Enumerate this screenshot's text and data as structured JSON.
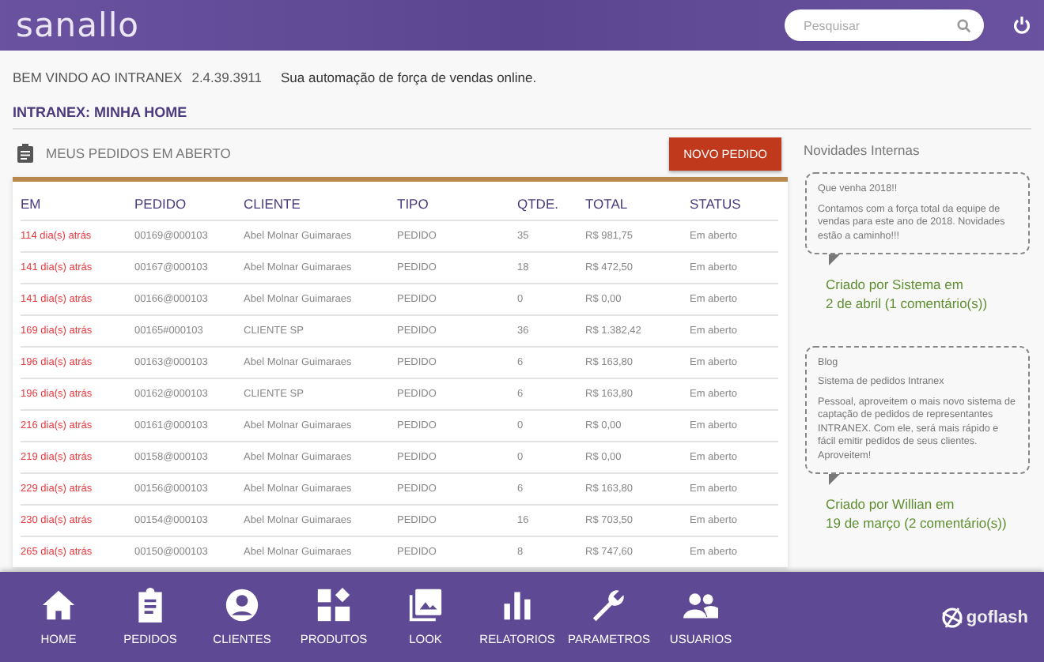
{
  "header": {
    "logo": "sanallo",
    "search": {
      "placeholder": "Pesquisar"
    }
  },
  "welcome": {
    "title": "BEM VINDO AO INTRANEX",
    "version": "2.4.39.3911",
    "tagline": "Sua automação de força de vendas online."
  },
  "page_title": "INTRANEX: MINHA HOME",
  "orders": {
    "title": "MEUS PEDIDOS EM ABERTO",
    "new_button": "NOVO PEDIDO",
    "columns": [
      "EM",
      "PEDIDO",
      "CLIENTE",
      "TIPO",
      "QTDE.",
      "TOTAL",
      "STATUS"
    ],
    "rows": [
      [
        "114 dia(s) atrás",
        "00169@000103",
        "Abel Molnar Guimaraes",
        "PEDIDO",
        "35",
        "R$ 981,75",
        "Em aberto"
      ],
      [
        "141 dia(s) atrás",
        "00167@000103",
        "Abel Molnar Guimaraes",
        "PEDIDO",
        "18",
        "R$ 472,50",
        "Em aberto"
      ],
      [
        "141 dia(s) atrás",
        "00166@000103",
        "Abel Molnar Guimaraes",
        "PEDIDO",
        "0",
        "R$ 0,00",
        "Em aberto"
      ],
      [
        "169 dia(s) atrás",
        "00165#000103",
        "CLIENTE SP",
        "PEDIDO",
        "36",
        "R$ 1.382,42",
        "Em aberto"
      ],
      [
        "196 dia(s) atrás",
        "00163@000103",
        "Abel Molnar Guimaraes",
        "PEDIDO",
        "6",
        "R$ 163,80",
        "Em aberto"
      ],
      [
        "196 dia(s) atrás",
        "00162@000103",
        "CLIENTE SP",
        "PEDIDO",
        "6",
        "R$ 163,80",
        "Em aberto"
      ],
      [
        "216 dia(s) atrás",
        "00161@000103",
        "Abel Molnar Guimaraes",
        "PEDIDO",
        "0",
        "R$ 0,00",
        "Em aberto"
      ],
      [
        "219 dia(s) atrás",
        "00158@000103",
        "Abel Molnar Guimaraes",
        "PEDIDO",
        "0",
        "R$ 0,00",
        "Em aberto"
      ],
      [
        "229 dia(s) atrás",
        "00156@000103",
        "Abel Molnar Guimaraes",
        "PEDIDO",
        "6",
        "R$ 163,80",
        "Em aberto"
      ],
      [
        "230 dia(s) atrás",
        "00154@000103",
        "Abel Molnar Guimaraes",
        "PEDIDO",
        "16",
        "R$ 703,50",
        "Em aberto"
      ],
      [
        "265 dia(s) atrás",
        "00150@000103",
        "Abel Molnar Guimaraes",
        "PEDIDO",
        "8",
        "R$ 747,60",
        "Em aberto"
      ]
    ]
  },
  "news": {
    "title": "Novidades Internas",
    "posts": [
      {
        "title": "Que venha 2018!!",
        "body": "Contamos com a força total da equipe de vendas para este ano de 2018. Novidades estão a caminho!!!",
        "created_line": "Criado por Sistema em",
        "date_line": "2 de abril (1 comentário(s))"
      },
      {
        "category": "Blog",
        "title": "Sistema de pedidos Intranex",
        "body": "Pessoal, aproveitem o mais novo sistema de captação de pedidos de representantes INTRANEX. Com ele, será mais rápido e fácil emitir pedidos de seus clientes. Aproveitem!",
        "created_line": "Criado por Willian em",
        "date_line": "19 de março (2 comentário(s))"
      }
    ]
  },
  "nav": [
    {
      "label": "HOME"
    },
    {
      "label": "PEDIDOS"
    },
    {
      "label": "CLIENTES"
    },
    {
      "label": "PRODUTOS"
    },
    {
      "label": "LOOK"
    },
    {
      "label": "RELATORIOS"
    },
    {
      "label": "PARAMETROS"
    },
    {
      "label": "USUARIOS"
    }
  ],
  "brand": "goflash"
}
